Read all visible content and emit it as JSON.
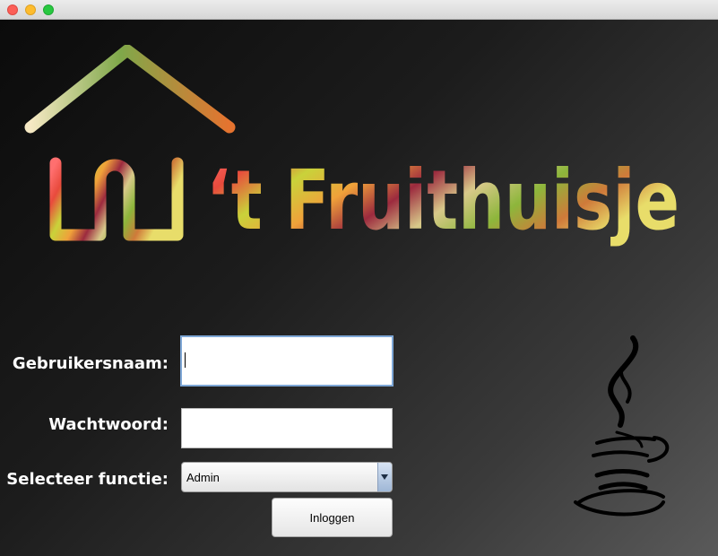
{
  "window": {
    "controls": [
      "close",
      "minimize",
      "maximize"
    ]
  },
  "logo": {
    "text": "‘t Fruithuisje",
    "icon": "house-icon"
  },
  "form": {
    "username_label": "Gebruikersnaam:",
    "username_value": "",
    "password_label": "Wachtwoord:",
    "password_value": "",
    "function_label": "Selecteer functie:",
    "function_selected": "Admin",
    "login_button": "Inloggen"
  },
  "decor": {
    "icon": "java-coffee-icon"
  },
  "colors": {
    "focus_ring": "#7ea7d6",
    "text": "#ffffff"
  }
}
